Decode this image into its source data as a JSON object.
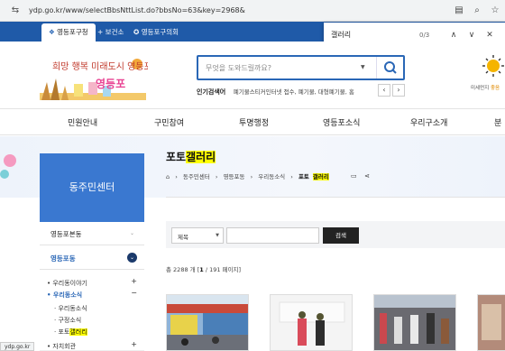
{
  "browser": {
    "url": "ydp.go.kr/www/selectBbsNttList.do?bbsNo=63&key=2968&",
    "find": {
      "query": "갤러리",
      "count": "0/3"
    }
  },
  "topbar": {
    "tabs": [
      "영등포구청",
      "+ 보건소",
      "영등포구의회"
    ]
  },
  "header": {
    "logo_text": "희망 행복 미래도시 영등포",
    "search_placeholder": "무엇을 도와드릴까요?",
    "popular_label": "인기검색어",
    "popular_items": "폐기물스티커인터넷 접수, 폐기물, 대형폐기물, 홈",
    "weather_label": "미세먼지",
    "weather_value": "좋음"
  },
  "gnb": [
    "민원안내",
    "구민참여",
    "투명행정",
    "영등포소식",
    "우리구소개",
    "분"
  ],
  "sidebar": {
    "title": "동주민센터",
    "items": [
      "영등포본동",
      "영등포동"
    ],
    "sub": {
      "group1": "우리동이야기",
      "group2": "우리동소식",
      "leaf1": "우리동소식",
      "leaf2": "구정소식",
      "leaf3_prefix": "포토",
      "leaf3_hl": "갤러리",
      "group3": "자치회관"
    }
  },
  "main": {
    "title_prefix": "포토",
    "title_hl": "갤러리",
    "breadcrumb": [
      "동주민센터",
      "영등포동",
      "우리동소식"
    ],
    "crumb_prefix": "포토",
    "crumb_hl": "갤러리",
    "filter_select": "제목",
    "search_btn": "검색",
    "total_prefix": "총 2288 개",
    "page_current": "1",
    "page_suffix": "/ 191 페이지"
  },
  "status_url": "ydp.go.kr"
}
